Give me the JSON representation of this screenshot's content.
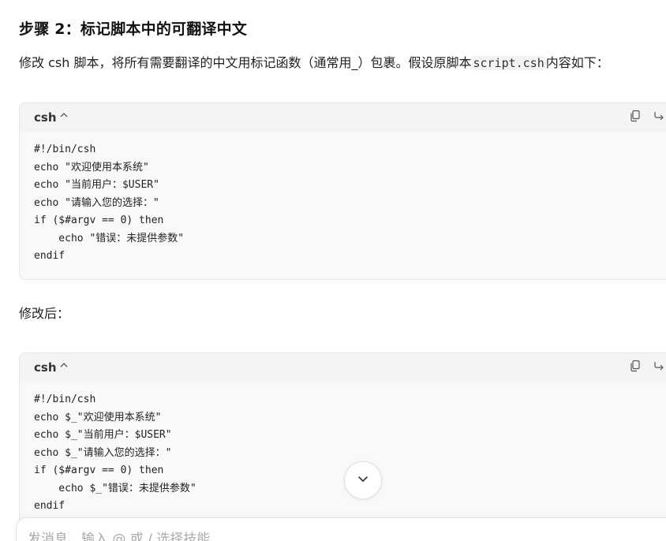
{
  "heading": "步骤 2：标记脚本中的可翻译中文",
  "intro": {
    "before": "修改 csh 脚本，将所有需要翻译的中文用标记函数（通常用_）包裹。假设原脚本",
    "code": "script.csh",
    "after": "内容如下："
  },
  "code_blocks": [
    {
      "lang": "csh",
      "lines": [
        "#!/bin/csh",
        "echo \"欢迎使用本系统\"",
        "echo \"当前用户：$USER\"",
        "echo \"请输入您的选择：\"",
        "if ($#argv == 0) then",
        "    echo \"错误：未提供参数\"",
        "endif"
      ]
    },
    {
      "lang": "csh",
      "lines": [
        "#!/bin/csh",
        "echo $_\"欢迎使用本系统\"",
        "echo $_\"当前用户：$USER\"",
        "echo $_\"请输入您的选择：\"",
        "if ($#argv == 0) then",
        "    echo $_\"错误：未提供参数\"",
        "endif"
      ]
    }
  ],
  "modified_label": "修改后：",
  "input": {
    "placeholder": "发消息、输入 @ 或 / 选择技能"
  },
  "icons": {
    "collapse": "chevron-up-icon",
    "copy": "copy-icon",
    "share": "share-icon",
    "edit": "edit-icon",
    "scroll_down": "chevron-down-icon"
  }
}
